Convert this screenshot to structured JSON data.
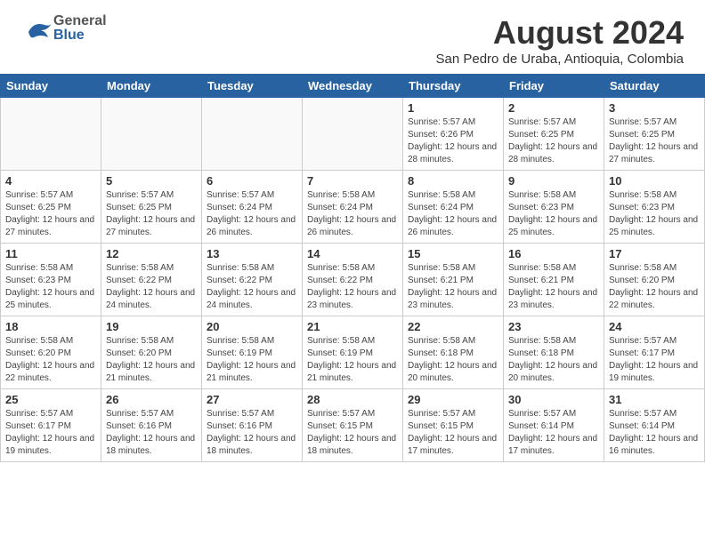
{
  "header": {
    "month_year": "August 2024",
    "location": "San Pedro de Uraba, Antioquia, Colombia",
    "logo_general": "General",
    "logo_blue": "Blue"
  },
  "calendar": {
    "days_of_week": [
      "Sunday",
      "Monday",
      "Tuesday",
      "Wednesday",
      "Thursday",
      "Friday",
      "Saturday"
    ],
    "weeks": [
      [
        {
          "day": "",
          "info": ""
        },
        {
          "day": "",
          "info": ""
        },
        {
          "day": "",
          "info": ""
        },
        {
          "day": "",
          "info": ""
        },
        {
          "day": "1",
          "info": "Sunrise: 5:57 AM\nSunset: 6:26 PM\nDaylight: 12 hours\nand 28 minutes."
        },
        {
          "day": "2",
          "info": "Sunrise: 5:57 AM\nSunset: 6:25 PM\nDaylight: 12 hours\nand 28 minutes."
        },
        {
          "day": "3",
          "info": "Sunrise: 5:57 AM\nSunset: 6:25 PM\nDaylight: 12 hours\nand 27 minutes."
        }
      ],
      [
        {
          "day": "4",
          "info": "Sunrise: 5:57 AM\nSunset: 6:25 PM\nDaylight: 12 hours\nand 27 minutes."
        },
        {
          "day": "5",
          "info": "Sunrise: 5:57 AM\nSunset: 6:25 PM\nDaylight: 12 hours\nand 27 minutes."
        },
        {
          "day": "6",
          "info": "Sunrise: 5:57 AM\nSunset: 6:24 PM\nDaylight: 12 hours\nand 26 minutes."
        },
        {
          "day": "7",
          "info": "Sunrise: 5:58 AM\nSunset: 6:24 PM\nDaylight: 12 hours\nand 26 minutes."
        },
        {
          "day": "8",
          "info": "Sunrise: 5:58 AM\nSunset: 6:24 PM\nDaylight: 12 hours\nand 26 minutes."
        },
        {
          "day": "9",
          "info": "Sunrise: 5:58 AM\nSunset: 6:23 PM\nDaylight: 12 hours\nand 25 minutes."
        },
        {
          "day": "10",
          "info": "Sunrise: 5:58 AM\nSunset: 6:23 PM\nDaylight: 12 hours\nand 25 minutes."
        }
      ],
      [
        {
          "day": "11",
          "info": "Sunrise: 5:58 AM\nSunset: 6:23 PM\nDaylight: 12 hours\nand 25 minutes."
        },
        {
          "day": "12",
          "info": "Sunrise: 5:58 AM\nSunset: 6:22 PM\nDaylight: 12 hours\nand 24 minutes."
        },
        {
          "day": "13",
          "info": "Sunrise: 5:58 AM\nSunset: 6:22 PM\nDaylight: 12 hours\nand 24 minutes."
        },
        {
          "day": "14",
          "info": "Sunrise: 5:58 AM\nSunset: 6:22 PM\nDaylight: 12 hours\nand 23 minutes."
        },
        {
          "day": "15",
          "info": "Sunrise: 5:58 AM\nSunset: 6:21 PM\nDaylight: 12 hours\nand 23 minutes."
        },
        {
          "day": "16",
          "info": "Sunrise: 5:58 AM\nSunset: 6:21 PM\nDaylight: 12 hours\nand 23 minutes."
        },
        {
          "day": "17",
          "info": "Sunrise: 5:58 AM\nSunset: 6:20 PM\nDaylight: 12 hours\nand 22 minutes."
        }
      ],
      [
        {
          "day": "18",
          "info": "Sunrise: 5:58 AM\nSunset: 6:20 PM\nDaylight: 12 hours\nand 22 minutes."
        },
        {
          "day": "19",
          "info": "Sunrise: 5:58 AM\nSunset: 6:20 PM\nDaylight: 12 hours\nand 21 minutes."
        },
        {
          "day": "20",
          "info": "Sunrise: 5:58 AM\nSunset: 6:19 PM\nDaylight: 12 hours\nand 21 minutes."
        },
        {
          "day": "21",
          "info": "Sunrise: 5:58 AM\nSunset: 6:19 PM\nDaylight: 12 hours\nand 21 minutes."
        },
        {
          "day": "22",
          "info": "Sunrise: 5:58 AM\nSunset: 6:18 PM\nDaylight: 12 hours\nand 20 minutes."
        },
        {
          "day": "23",
          "info": "Sunrise: 5:58 AM\nSunset: 6:18 PM\nDaylight: 12 hours\nand 20 minutes."
        },
        {
          "day": "24",
          "info": "Sunrise: 5:57 AM\nSunset: 6:17 PM\nDaylight: 12 hours\nand 19 minutes."
        }
      ],
      [
        {
          "day": "25",
          "info": "Sunrise: 5:57 AM\nSunset: 6:17 PM\nDaylight: 12 hours\nand 19 minutes."
        },
        {
          "day": "26",
          "info": "Sunrise: 5:57 AM\nSunset: 6:16 PM\nDaylight: 12 hours\nand 18 minutes."
        },
        {
          "day": "27",
          "info": "Sunrise: 5:57 AM\nSunset: 6:16 PM\nDaylight: 12 hours\nand 18 minutes."
        },
        {
          "day": "28",
          "info": "Sunrise: 5:57 AM\nSunset: 6:15 PM\nDaylight: 12 hours\nand 18 minutes."
        },
        {
          "day": "29",
          "info": "Sunrise: 5:57 AM\nSunset: 6:15 PM\nDaylight: 12 hours\nand 17 minutes."
        },
        {
          "day": "30",
          "info": "Sunrise: 5:57 AM\nSunset: 6:14 PM\nDaylight: 12 hours\nand 17 minutes."
        },
        {
          "day": "31",
          "info": "Sunrise: 5:57 AM\nSunset: 6:14 PM\nDaylight: 12 hours\nand 16 minutes."
        }
      ]
    ]
  }
}
